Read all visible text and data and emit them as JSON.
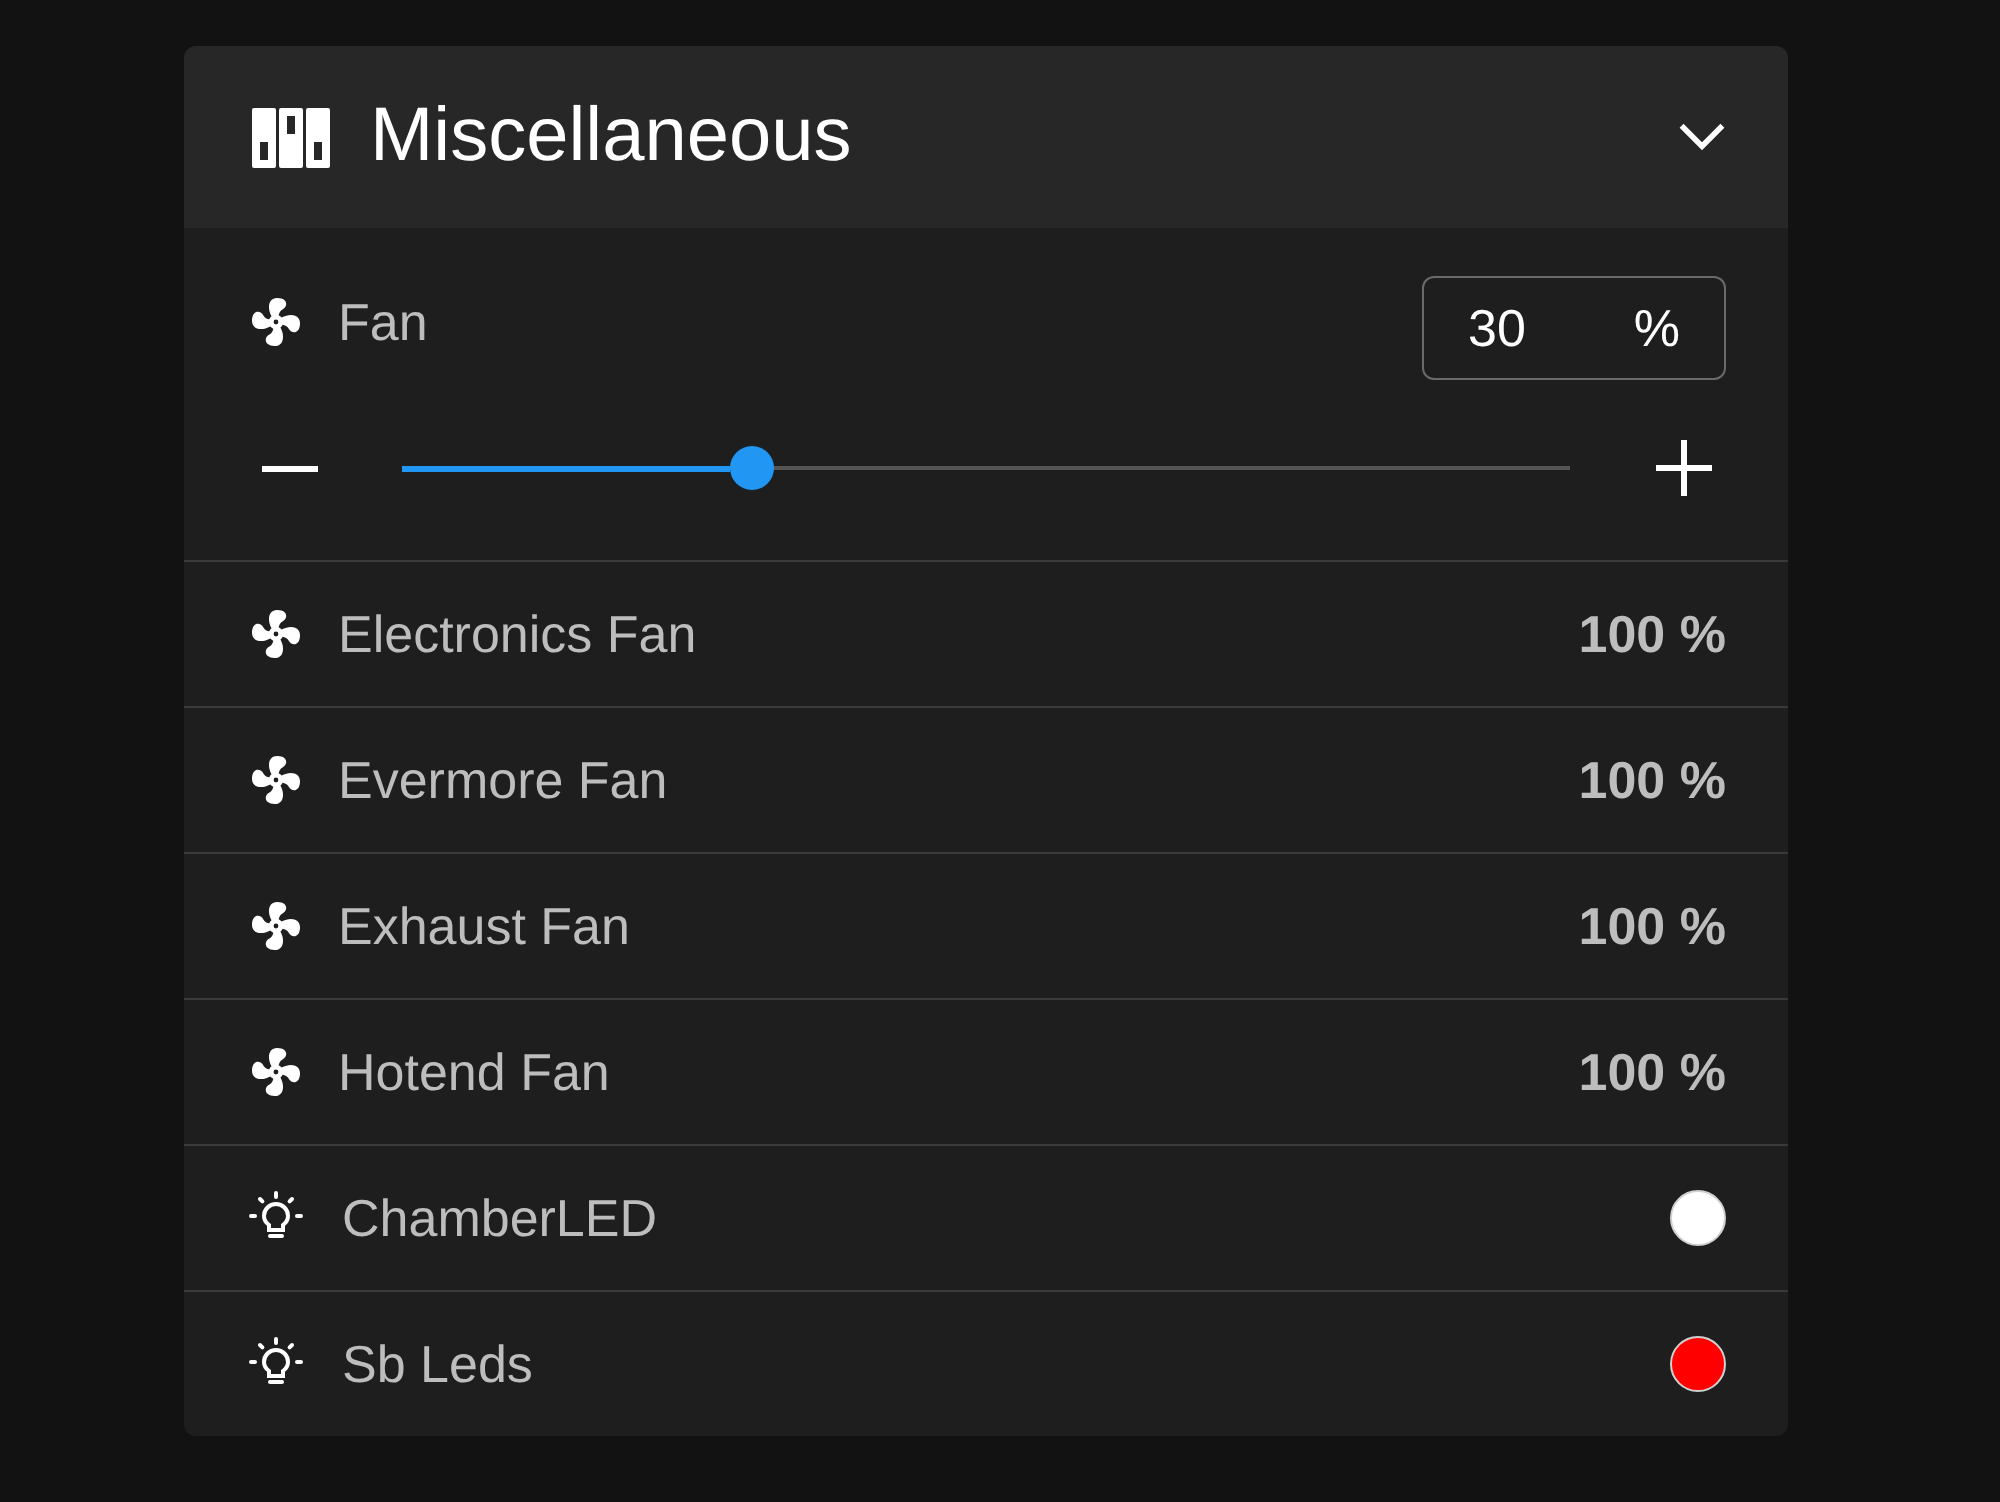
{
  "panel": {
    "title": "Miscellaneous",
    "expanded": true
  },
  "fan": {
    "label": "Fan",
    "value": "30",
    "unit": "%",
    "level": 0.3
  },
  "rows": [
    {
      "kind": "fan",
      "label": "Electronics Fan",
      "value": "100 %"
    },
    {
      "kind": "fan",
      "label": "Evermore Fan",
      "value": "100 %"
    },
    {
      "kind": "fan",
      "label": "Exhaust Fan",
      "value": "100 %"
    },
    {
      "kind": "fan",
      "label": "Hotend Fan",
      "value": "100 %"
    },
    {
      "kind": "led",
      "label": "ChamberLED",
      "color": "#ffffff"
    },
    {
      "kind": "led",
      "label": "Sb Leds",
      "color": "#ff0000"
    }
  ]
}
